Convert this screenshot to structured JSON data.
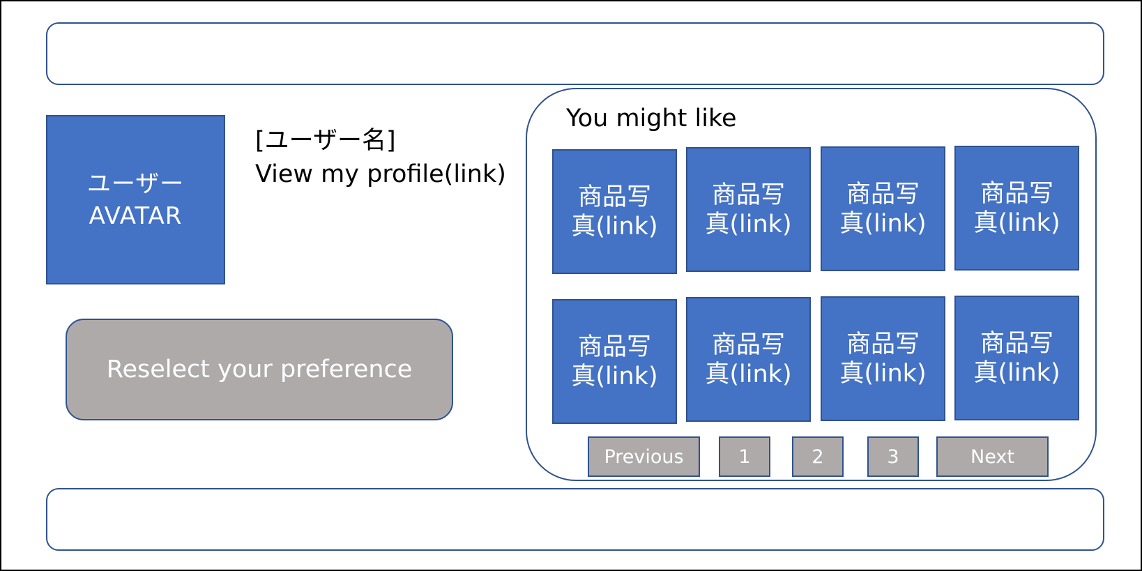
{
  "header": {},
  "profile": {
    "avatar_line1": "ユーザー",
    "avatar_line2": "AVATAR",
    "username": "[ユーザー名]",
    "profile_link": "View my profile(link)"
  },
  "preference": {
    "reselect_label": "Reselect your preference"
  },
  "recommendations": {
    "title": "You might like",
    "products": [
      {
        "line1": "商品写",
        "line2": "真(link)"
      },
      {
        "line1": "商品写",
        "line2": "真(link)"
      },
      {
        "line1": "商品写",
        "line2": "真(link)"
      },
      {
        "line1": "商品写",
        "line2": "真(link)"
      },
      {
        "line1": "商品写",
        "line2": "真(link)"
      },
      {
        "line1": "商品写",
        "line2": "真(link)"
      },
      {
        "line1": "商品写",
        "line2": "真(link)"
      },
      {
        "line1": "商品写",
        "line2": "真(link)"
      }
    ],
    "pagination": {
      "previous": "Previous",
      "pages": [
        "1",
        "2",
        "3"
      ],
      "next": "Next"
    }
  },
  "footer": {},
  "colors": {
    "accent_blue": "#4472c4",
    "border_blue": "#2f528f",
    "button_gray": "#aeaaaa"
  }
}
